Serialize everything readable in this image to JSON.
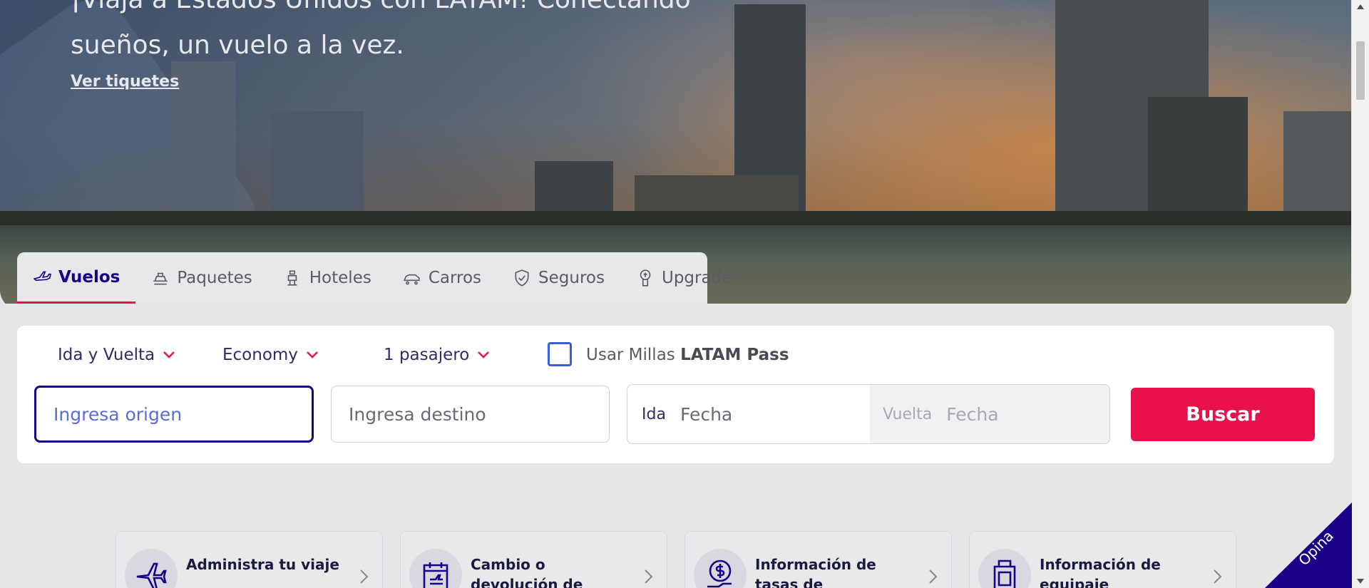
{
  "hero": {
    "headline": "¡Viaja a Estados Unidos con LATAM! Conectando sueños, un vuelo a la vez.",
    "link": "Ver tiquetes"
  },
  "tabs": [
    {
      "label": "Vuelos",
      "icon": "plane-icon",
      "active": true
    },
    {
      "label": "Paquetes",
      "icon": "package-icon"
    },
    {
      "label": "Hoteles",
      "icon": "hotel-icon"
    },
    {
      "label": "Carros",
      "icon": "car-icon"
    },
    {
      "label": "Seguros",
      "icon": "shield-icon"
    },
    {
      "label": "Upgrade",
      "icon": "upgrade-icon"
    }
  ],
  "search": {
    "trip_type": "Ida y Vuelta",
    "cabin": "Economy",
    "passengers": "1 pasajero",
    "miles_prefix": "Usar Millas",
    "miles_brand": "LATAM Pass",
    "origin_placeholder": "Ingresa origen",
    "destination_placeholder": "Ingresa destino",
    "depart_label": "Ida",
    "depart_placeholder": "Fecha",
    "return_label": "Vuelta",
    "return_placeholder": "Fecha",
    "search_button": "Buscar"
  },
  "cards": [
    {
      "label": "Administra tu viaje",
      "icon": "plane-icon"
    },
    {
      "label": "Cambio o devolución de pasajes",
      "icon": "calendar-plane-icon"
    },
    {
      "label": "Información de tasas de embarque",
      "icon": "money-icon"
    },
    {
      "label": "Información de equipaje",
      "icon": "luggage-icon"
    }
  ],
  "feedback": "Opina",
  "colors": {
    "brand": "#1b0088",
    "accent": "#e8114b"
  }
}
